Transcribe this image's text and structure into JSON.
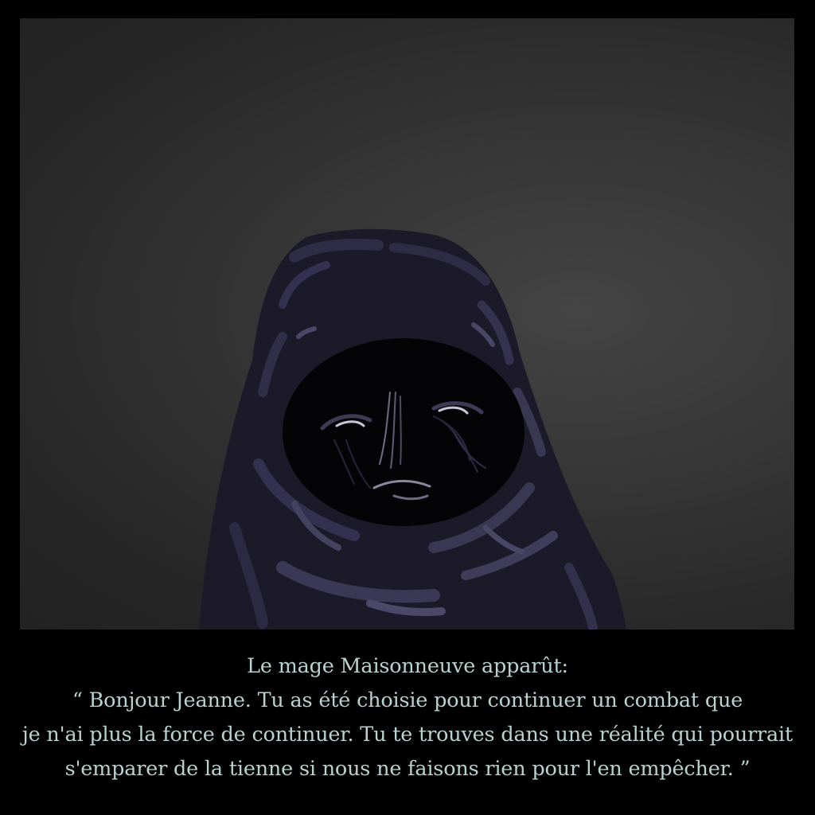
{
  "dialogue": {
    "lines": [
      "Le mage Maisonneuve apparût:",
      "“ Bonjour Jeanne. Tu as été choisie pour continuer un combat que",
      "je n'ai plus la force de continuer. Tu te trouves dans une réalité qui pourrait",
      "s'emparer de la tienne si nous ne faisons rien pour l'en empêcher. ”"
    ]
  },
  "colors": {
    "background": "#000000",
    "scene_gradient": "#333333",
    "hood": "#1c1a29",
    "hood_highlight": "#3a3752",
    "face_shadow": "#040406",
    "text": "#b7d3d1"
  }
}
